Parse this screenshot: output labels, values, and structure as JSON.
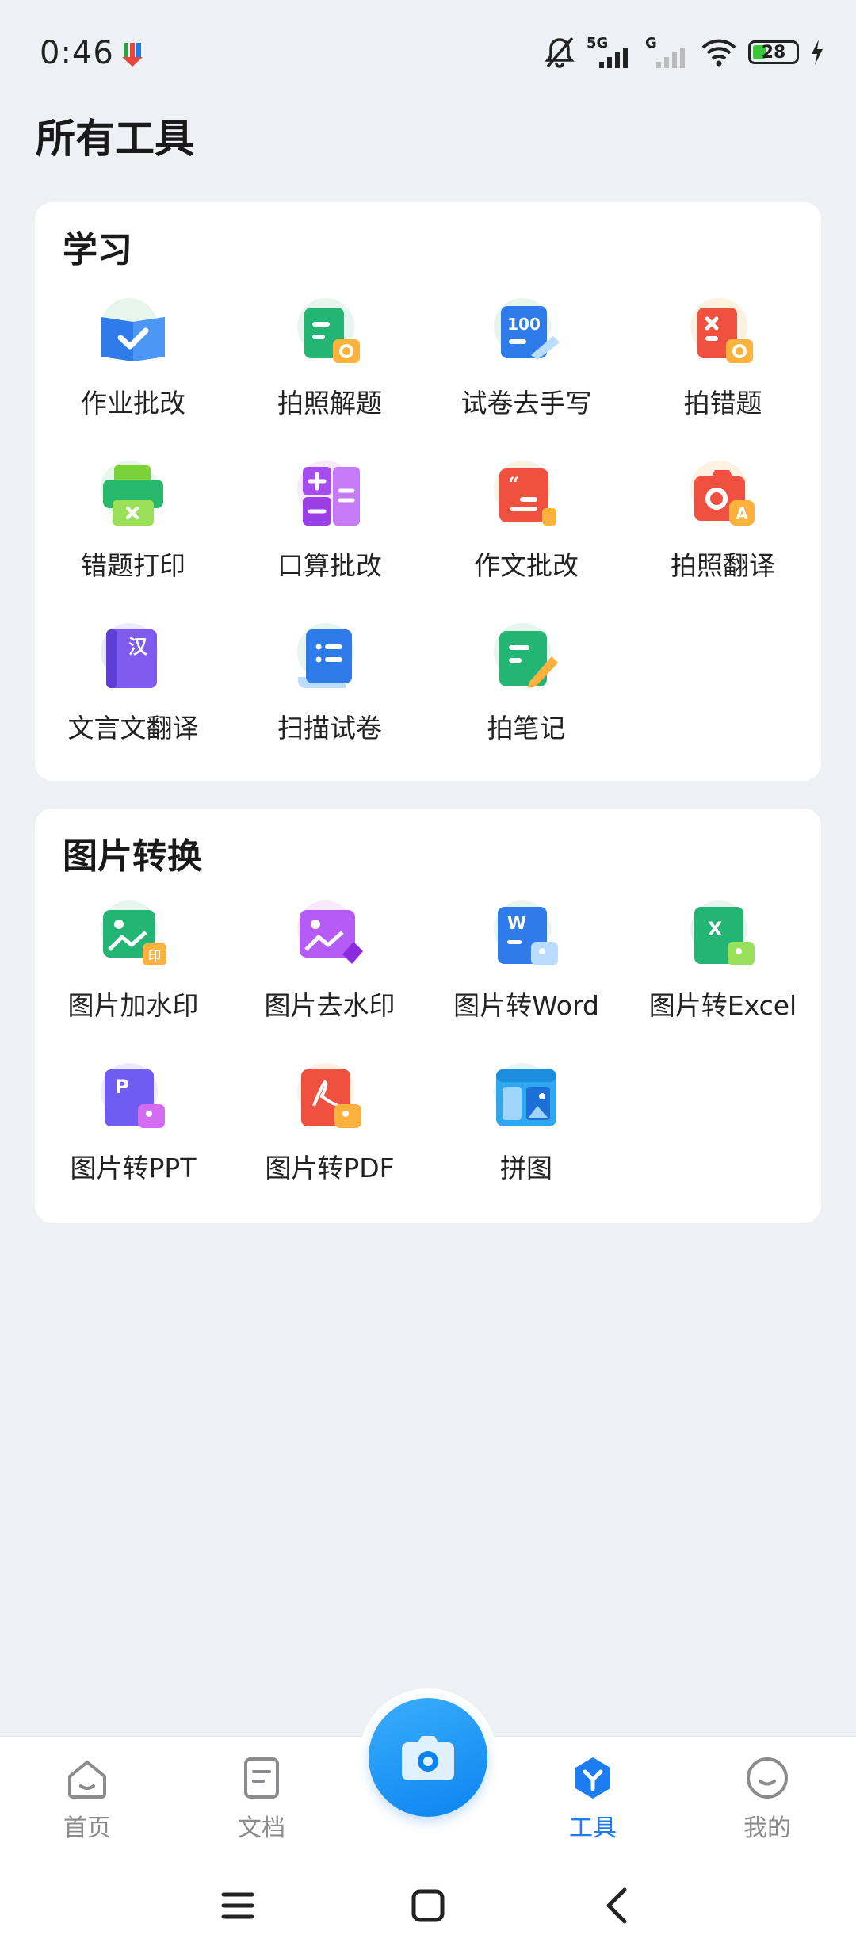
{
  "status_bar": {
    "time": "0:46",
    "network_5g": "5G",
    "network_g": "G",
    "battery": "28",
    "icons": [
      "app-notification-icon",
      "mute-icon",
      "signal-icon",
      "signal-icon",
      "wifi-icon",
      "battery-icon",
      "charging-icon"
    ]
  },
  "page": {
    "title": "所有工具"
  },
  "sections": [
    {
      "title": "学习",
      "tools": [
        {
          "label": "作业批改",
          "icon": "homework-check-icon"
        },
        {
          "label": "拍照解题",
          "icon": "photo-solve-icon"
        },
        {
          "label": "试卷去手写",
          "icon": "remove-handwriting-icon"
        },
        {
          "label": "拍错题",
          "icon": "photo-mistake-icon"
        },
        {
          "label": "错题打印",
          "icon": "mistake-print-icon"
        },
        {
          "label": "口算批改",
          "icon": "mental-math-icon"
        },
        {
          "label": "作文批改",
          "icon": "essay-check-icon"
        },
        {
          "label": "拍照翻译",
          "icon": "photo-translate-icon"
        },
        {
          "label": "文言文翻译",
          "icon": "classical-chinese-icon"
        },
        {
          "label": "扫描试卷",
          "icon": "scan-paper-icon"
        },
        {
          "label": "拍笔记",
          "icon": "photo-notes-icon"
        }
      ]
    },
    {
      "title": "图片转换",
      "tools": [
        {
          "label": "图片加水印",
          "icon": "add-watermark-icon"
        },
        {
          "label": "图片去水印",
          "icon": "remove-watermark-icon"
        },
        {
          "label": "图片转Word",
          "icon": "image-to-word-icon"
        },
        {
          "label": "图片转Excel",
          "icon": "image-to-excel-icon"
        },
        {
          "label": "图片转PPT",
          "icon": "image-to-ppt-icon"
        },
        {
          "label": "图片转PDF",
          "icon": "image-to-pdf-icon"
        },
        {
          "label": "拼图",
          "icon": "collage-icon"
        }
      ]
    }
  ],
  "bottom_nav": {
    "items": [
      {
        "label": "首页",
        "icon": "home-icon"
      },
      {
        "label": "文档",
        "icon": "document-icon"
      },
      {
        "label": "工具",
        "icon": "tools-icon",
        "active": true
      },
      {
        "label": "我的",
        "icon": "profile-icon"
      }
    ],
    "center_icon": "camera-icon"
  },
  "colors": {
    "accent": "#1e7cf2",
    "background": "#eff0f6"
  }
}
